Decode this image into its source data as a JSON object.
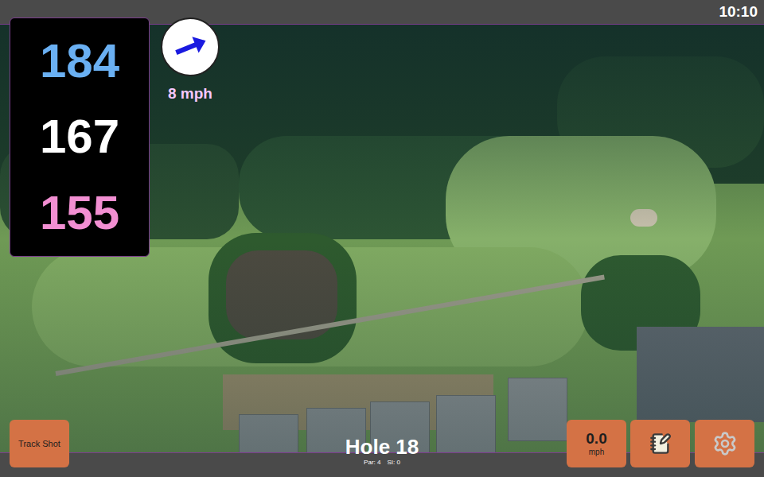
{
  "clock": "10:10",
  "distances": [
    {
      "value": "184",
      "color": "#6ab0f3"
    },
    {
      "value": "167",
      "color": "#ffffff"
    },
    {
      "value": "155",
      "color": "#f28fd2"
    }
  ],
  "wind": {
    "speed": "8 mph"
  },
  "hole": {
    "title": "Hole 18",
    "par": "Par: 4",
    "si": "SI: 0"
  },
  "buttons": {
    "track_shot": "Track Shot",
    "speed": "0.0",
    "speed_unit": "mph"
  }
}
